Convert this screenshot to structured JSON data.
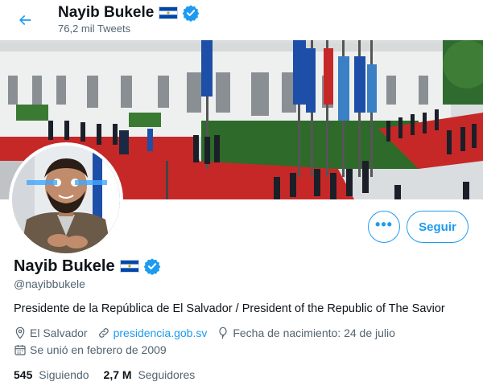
{
  "header": {
    "name": "Nayib Bukele",
    "tweet_count": "76,2 mil Tweets"
  },
  "profile": {
    "name": "Nayib Bukele",
    "handle": "@nayibbukele",
    "bio": "Presidente de la República de El Salvador / President of the Republic of The Savior",
    "location": "El Salvador",
    "website": "presidencia.gob.sv",
    "birthday": "Fecha de nacimiento: 24 de julio",
    "joined": "Se unió en febrero de 2009"
  },
  "actions": {
    "more_label": "•••",
    "follow_label": "Seguir"
  },
  "stats": {
    "following_count": "545",
    "following_label": "Siguiendo",
    "followers_count": "2,7 M",
    "followers_label": "Seguidores"
  },
  "colors": {
    "accent": "#1d9bf0",
    "secondary_text": "#536471",
    "flag_blue": "#0047ab"
  },
  "icons": [
    "back-arrow-icon",
    "flag-icon",
    "verified-badge-icon",
    "location-icon",
    "link-icon",
    "balloon-icon",
    "calendar-icon"
  ]
}
